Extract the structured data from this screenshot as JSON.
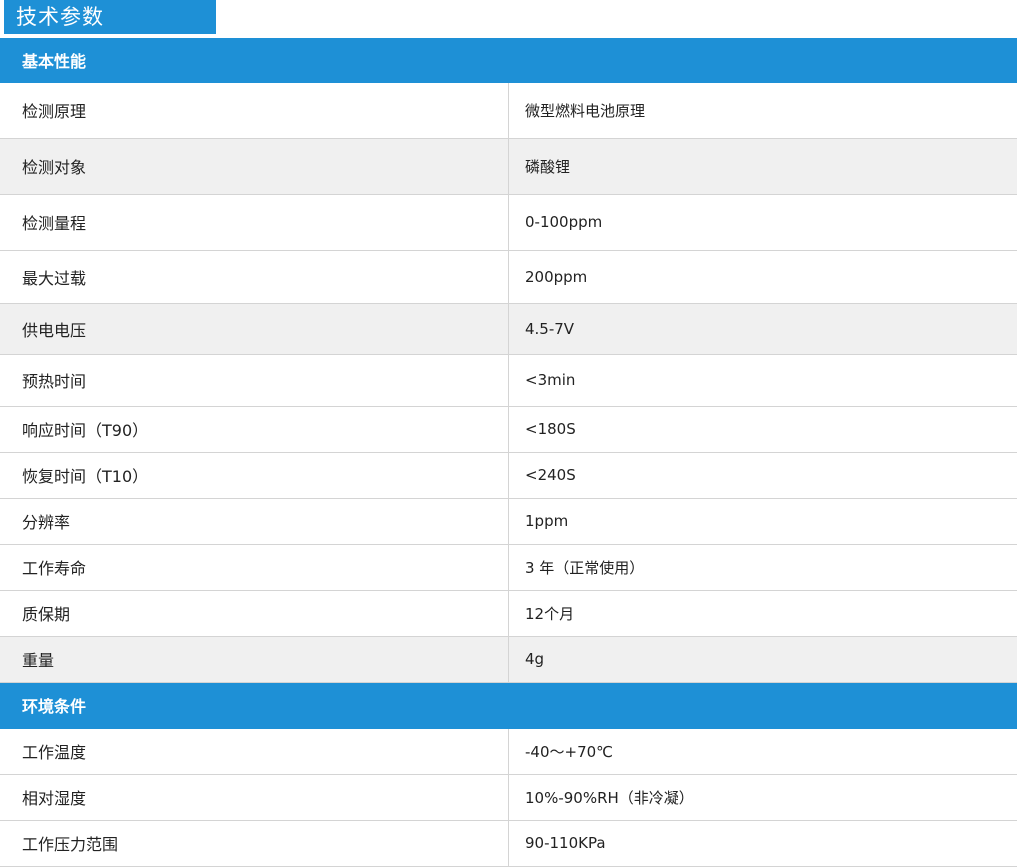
{
  "title": "技术参数",
  "sections": [
    {
      "heading": "基本性能",
      "rows": [
        {
          "label": "检测原理",
          "value": "微型燃料电池原理"
        },
        {
          "label": "检测对象",
          "value": "磷酸锂"
        },
        {
          "label": "检测量程",
          "value": "0-100ppm"
        },
        {
          "label": "最大过载",
          "value": "200ppm"
        },
        {
          "label": "供电电压",
          "value": "4.5-7V"
        },
        {
          "label": "预热时间",
          "value": "<3min"
        },
        {
          "label": "响应时间（T90）",
          "value": "<180S"
        },
        {
          "label": "恢复时间（T10）",
          "value": "<240S"
        },
        {
          "label": "分辨率",
          "value": "1ppm"
        },
        {
          "label": "工作寿命",
          "value": "3 年（正常使用）"
        },
        {
          "label": "质保期",
          "value": "12个月"
        },
        {
          "label": "重量",
          "value": "4g"
        }
      ]
    },
    {
      "heading": "环境条件",
      "rows": [
        {
          "label": "工作温度",
          "value": "-40～+70℃"
        },
        {
          "label": "相对湿度",
          "value": "10%-90%RH（非冷凝）"
        },
        {
          "label": "工作压力范围",
          "value": "90-110KPa"
        }
      ]
    }
  ],
  "colors": {
    "accent": "#1e90d6",
    "row_alt": "#f0f0f0",
    "border": "#d4d4d4"
  }
}
